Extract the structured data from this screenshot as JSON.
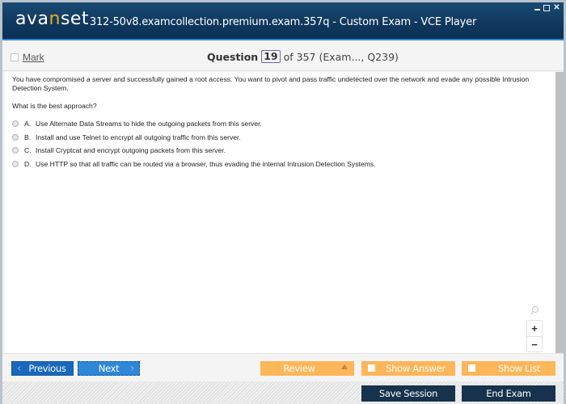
{
  "window": {
    "logo_pre": "ava",
    "logo_accent": "n",
    "logo_post": "set",
    "title": "312-50v8.examcollection.premium.exam.357q - Custom Exam - VCE Player",
    "controls": {
      "minimize": "",
      "maximize": "",
      "close": "✕"
    }
  },
  "header": {
    "mark_label": "Mark",
    "question_label": "Question",
    "question_number": "19",
    "question_of": "of 357 (Exam..., Q239)"
  },
  "question": {
    "text": "You have compromised a server and successfully gained a root access. You want to pivot and pass traffic undetected over the network and evade any possible Intrusion Detection System.",
    "prompt": "What is the best approach?",
    "options": [
      {
        "letter": "A.",
        "text": "Use Alternate Data Streams to hide the outgoing packets from this server."
      },
      {
        "letter": "B.",
        "text": "Install and use Telnet to encrypt all outgoing traffic from this server."
      },
      {
        "letter": "C.",
        "text": "Install Cryptcat and encrypt outgoing packets from this server."
      },
      {
        "letter": "D.",
        "text": "Use HTTP so that all traffic can be routed via a browser, thus evading the internal Intrusion Detection Systems."
      }
    ]
  },
  "zoom": {
    "in": "+",
    "out": "−"
  },
  "nav": {
    "previous": "Previous",
    "next": "Next",
    "review": "Review",
    "show_answer": "Show Answer",
    "show_list": "Show List",
    "prev_icon": "‹",
    "next_icon": "›"
  },
  "footer": {
    "save_session": "Save Session",
    "end_exam": "End Exam"
  },
  "colors": {
    "titlebar": "#0f375d",
    "accent_orange": "#ffb658",
    "nav_blue": "#1868bc",
    "footer_dark": "#16324c"
  }
}
